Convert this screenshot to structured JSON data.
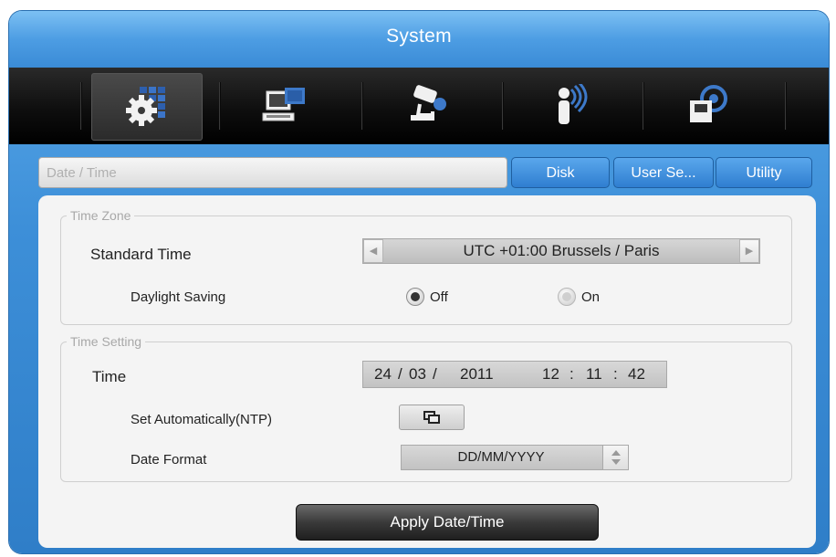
{
  "window": {
    "title": "System"
  },
  "toolbar": {
    "icons": [
      "settings-grid-icon",
      "network-computer-icon",
      "camera-icon",
      "sensor-person-icon",
      "storage-disk-icon"
    ],
    "active_index": 0
  },
  "tabs": {
    "active": "Date / Time",
    "items": [
      "Disk",
      "User Se...",
      "Utility"
    ]
  },
  "time_zone": {
    "group_label": "Time Zone",
    "standard_time_label": "Standard Time",
    "value": "UTC +01:00 Brussels / Paris",
    "daylight_saving_label": "Daylight Saving",
    "daylight_options": [
      "Off",
      "On"
    ],
    "daylight_selected": "Off"
  },
  "time_setting": {
    "group_label": "Time Setting",
    "time_label": "Time",
    "day": "24",
    "month": "03",
    "year": "2011",
    "hour": "12",
    "minute": "11",
    "second": "42",
    "sep_date": "/",
    "sep_time": ":",
    "ntp_label": "Set Automatically(NTP)",
    "date_format_label": "Date Format",
    "date_format_value": "DD/MM/YYYY"
  },
  "actions": {
    "apply_label": "Apply Date/Time"
  }
}
